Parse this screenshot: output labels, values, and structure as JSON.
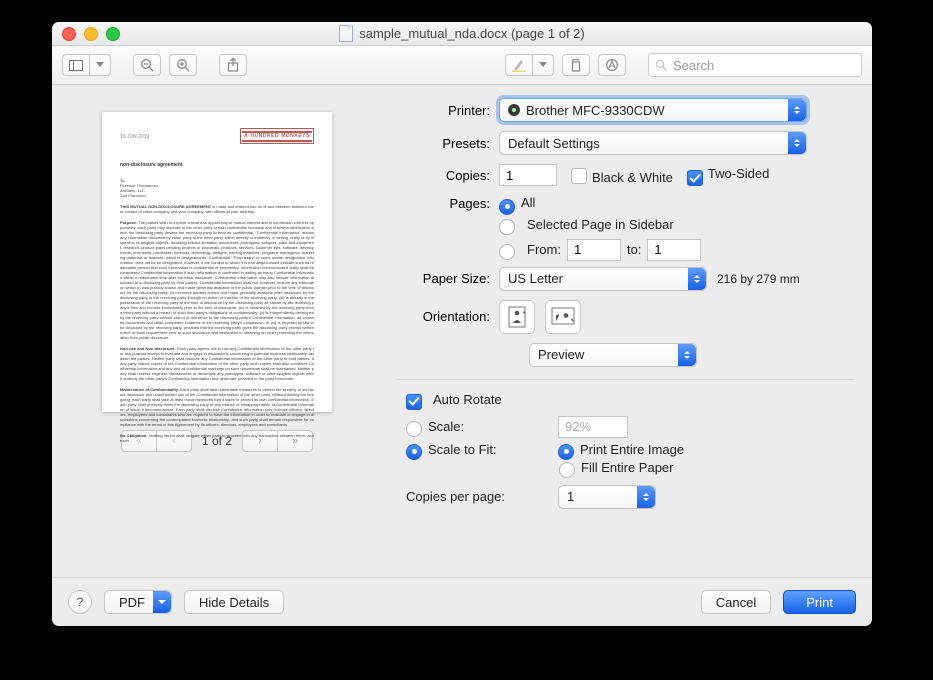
{
  "window": {
    "title": "sample_mutual_nda.docx (page 1 of 2)"
  },
  "toolbar": {
    "search_placeholder": "Search"
  },
  "preview": {
    "page_indicator": "1 of 2"
  },
  "labels": {
    "printer": "Printer:",
    "presets": "Presets:",
    "copies": "Copies:",
    "black_white": "Black & White",
    "two_sided": "Two-Sided",
    "pages": "Pages:",
    "all": "All",
    "selected_page": "Selected Page in Sidebar",
    "from": "From:",
    "to": "to:",
    "paper_size": "Paper Size:",
    "paper_dim": "216 by 279 mm",
    "orientation": "Orientation:",
    "auto_rotate": "Auto Rotate",
    "scale": "Scale:",
    "scale_to_fit": "Scale to Fit:",
    "print_entire": "Print Entire Image",
    "fill_entire": "Fill Entire Paper",
    "copies_per_page": "Copies per page:"
  },
  "values": {
    "printer": "Brother MFC-9330CDW",
    "presets": "Default Settings",
    "copies": "1",
    "from": "1",
    "to": "1",
    "paper_size": "US Letter",
    "module": "Preview",
    "scale_pct": "92%",
    "copies_per_page": "1"
  },
  "state": {
    "black_white": false,
    "two_sided": true,
    "pages_mode": "all",
    "auto_rotate": true,
    "scale_mode": "fit",
    "fit_mode": "print_entire"
  },
  "footer": {
    "help": "?",
    "pdf": "PDF",
    "hide_details": "Hide Details",
    "cancel": "Cancel",
    "print": "Print"
  }
}
